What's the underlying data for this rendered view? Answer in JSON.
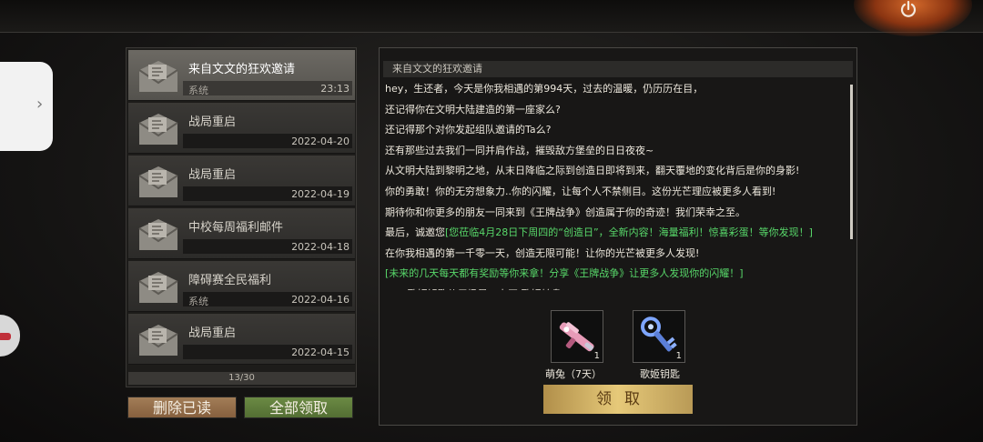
{
  "colors": {
    "accent_green_text": "#58d86a",
    "delete_button": "#8e6a45",
    "claim_all_button": "#5f7c3b",
    "claim_button_gold": "#d8b868"
  },
  "icons": {
    "power": "power-icon",
    "mail": "envelope-icon",
    "side_tab": "chevron-right-icon"
  },
  "mail_list": {
    "items": [
      {
        "title": "来自文文的狂欢邀请",
        "tag": "系统",
        "date": "23:13",
        "selected": true
      },
      {
        "title": "战局重启",
        "tag": "",
        "date": "2022-04-20",
        "selected": false
      },
      {
        "title": "战局重启",
        "tag": "",
        "date": "2022-04-19",
        "selected": false
      },
      {
        "title": "中校每周福利邮件",
        "tag": "",
        "date": "2022-04-18",
        "selected": false
      },
      {
        "title": "障碍赛全民福利",
        "tag": "系统",
        "date": "2022-04-16",
        "selected": false
      },
      {
        "title": "战局重启",
        "tag": "",
        "date": "2022-04-15",
        "selected": false
      }
    ],
    "page_indicator": "13/30",
    "delete_read_label": "删除已读",
    "claim_all_label": "全部领取"
  },
  "detail": {
    "header": "来自文文的狂欢邀请",
    "lines": [
      {
        "text": "hey，生还者，今天是你我相遇的第994天，过去的温暖，仍历历在目，",
        "green": false
      },
      {
        "text": "还记得你在文明大陆建造的第一座家么?",
        "green": false
      },
      {
        "text": "还记得那个对你发起组队邀请的Ta么?",
        "green": false
      },
      {
        "text": "还有那些过去我们一同并肩作战，摧毁敌方堡垒的日日夜夜~",
        "green": false
      },
      {
        "text": "从文明大陆到黎明之地，从末日降临之际到创造日即将到来，翻天覆地的变化背后是你的身影!",
        "green": false
      },
      {
        "text": "你的勇敢！你的无穷想象力..你的闪耀，让每个人不禁侧目。这份光芒理应被更多人看到!",
        "green": false
      },
      {
        "text": "期待你和你更多的朋友一同来到《王牌战争》创造属于你的奇迹！我们荣幸之至。",
        "green": false
      },
      {
        "text_prefix": "最后，诚邀您",
        "text": "[您莅临4月28日下周四的“创造日”，全新内容！海量福利！惊喜彩蛋！等你发现！]",
        "green": true
      },
      {
        "text": "在你我相遇的第一千零一天，创造无限可能！让你的光芒被更多人发现!",
        "green": false
      },
      {
        "text": "[未来的几天每天都有奖励等你来拿！分享《王牌战争》让更多人发现你的闪耀！]",
        "green": true
      },
      {
        "text": "PS：歌姬钥匙使用场景：大厅-歌姬转盘",
        "green": false
      }
    ],
    "rewards": [
      {
        "name": "萌兔（7天）",
        "count": "1",
        "icon": "pink-rifle-icon"
      },
      {
        "name": "歌姬钥匙",
        "count": "1",
        "icon": "key-icon"
      }
    ],
    "claim_label": "领取"
  }
}
